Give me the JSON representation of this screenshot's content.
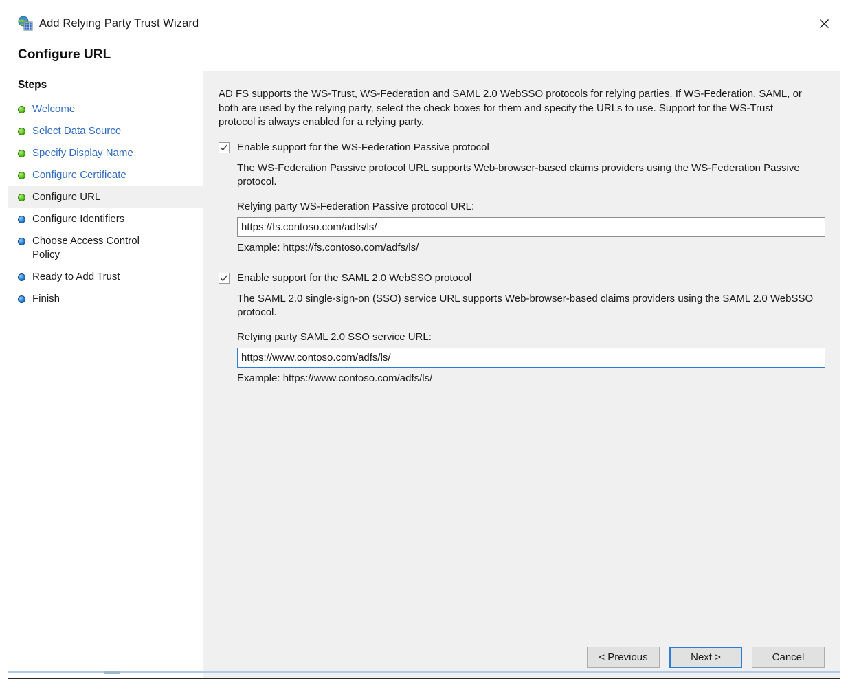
{
  "window": {
    "title": "Add Relying Party Trust Wizard",
    "icon": "adfs-globe-server-icon",
    "close_label": "✕"
  },
  "page": {
    "title": "Configure URL"
  },
  "sidebar": {
    "title": "Steps",
    "items": [
      {
        "label": "Welcome",
        "state": "done"
      },
      {
        "label": "Select Data Source",
        "state": "done"
      },
      {
        "label": "Specify Display Name",
        "state": "done"
      },
      {
        "label": "Configure Certificate",
        "state": "done"
      },
      {
        "label": "Configure URL",
        "state": "current"
      },
      {
        "label": "Configure Identifiers",
        "state": "future"
      },
      {
        "label": "Choose Access Control\nPolicy",
        "state": "future"
      },
      {
        "label": "Ready to Add Trust",
        "state": "future"
      },
      {
        "label": "Finish",
        "state": "future"
      }
    ]
  },
  "main": {
    "intro": "AD FS supports the WS-Trust, WS-Federation and SAML 2.0 WebSSO protocols for relying parties.  If WS-Federation, SAML, or both are used by the relying party, select the check boxes for them and specify the URLs to use.  Support for the WS-Trust protocol is always enabled for a relying party.",
    "wsfed": {
      "checkbox_label": "Enable support for the WS-Federation Passive protocol",
      "checked": true,
      "description": "The WS-Federation Passive protocol URL supports Web-browser-based claims providers using the WS-Federation Passive protocol.",
      "field_label": "Relying party WS-Federation Passive protocol URL:",
      "field_value": "https://fs.contoso.com/adfs/ls/",
      "field_focused": false,
      "example": "Example: https://fs.contoso.com/adfs/ls/"
    },
    "saml": {
      "checkbox_label": "Enable support for the SAML 2.0 WebSSO protocol",
      "checked": true,
      "description": "The SAML 2.0 single-sign-on (SSO) service URL supports Web-browser-based claims providers using the SAML 2.0 WebSSO protocol.",
      "field_label": "Relying party SAML 2.0 SSO service URL:",
      "field_value": "https://www.contoso.com/adfs/ls/",
      "field_focused": true,
      "example": "Example: https://www.contoso.com/adfs/ls/"
    }
  },
  "footer": {
    "previous_label": "< Previous",
    "next_label": "Next >",
    "cancel_label": "Cancel"
  },
  "colors": {
    "accent": "#2a7fd4",
    "link": "#2f6cc0",
    "done_bullet": "#5dc221",
    "todo_bullet": "#2a7fd4",
    "content_bg": "#f0f0f0"
  }
}
